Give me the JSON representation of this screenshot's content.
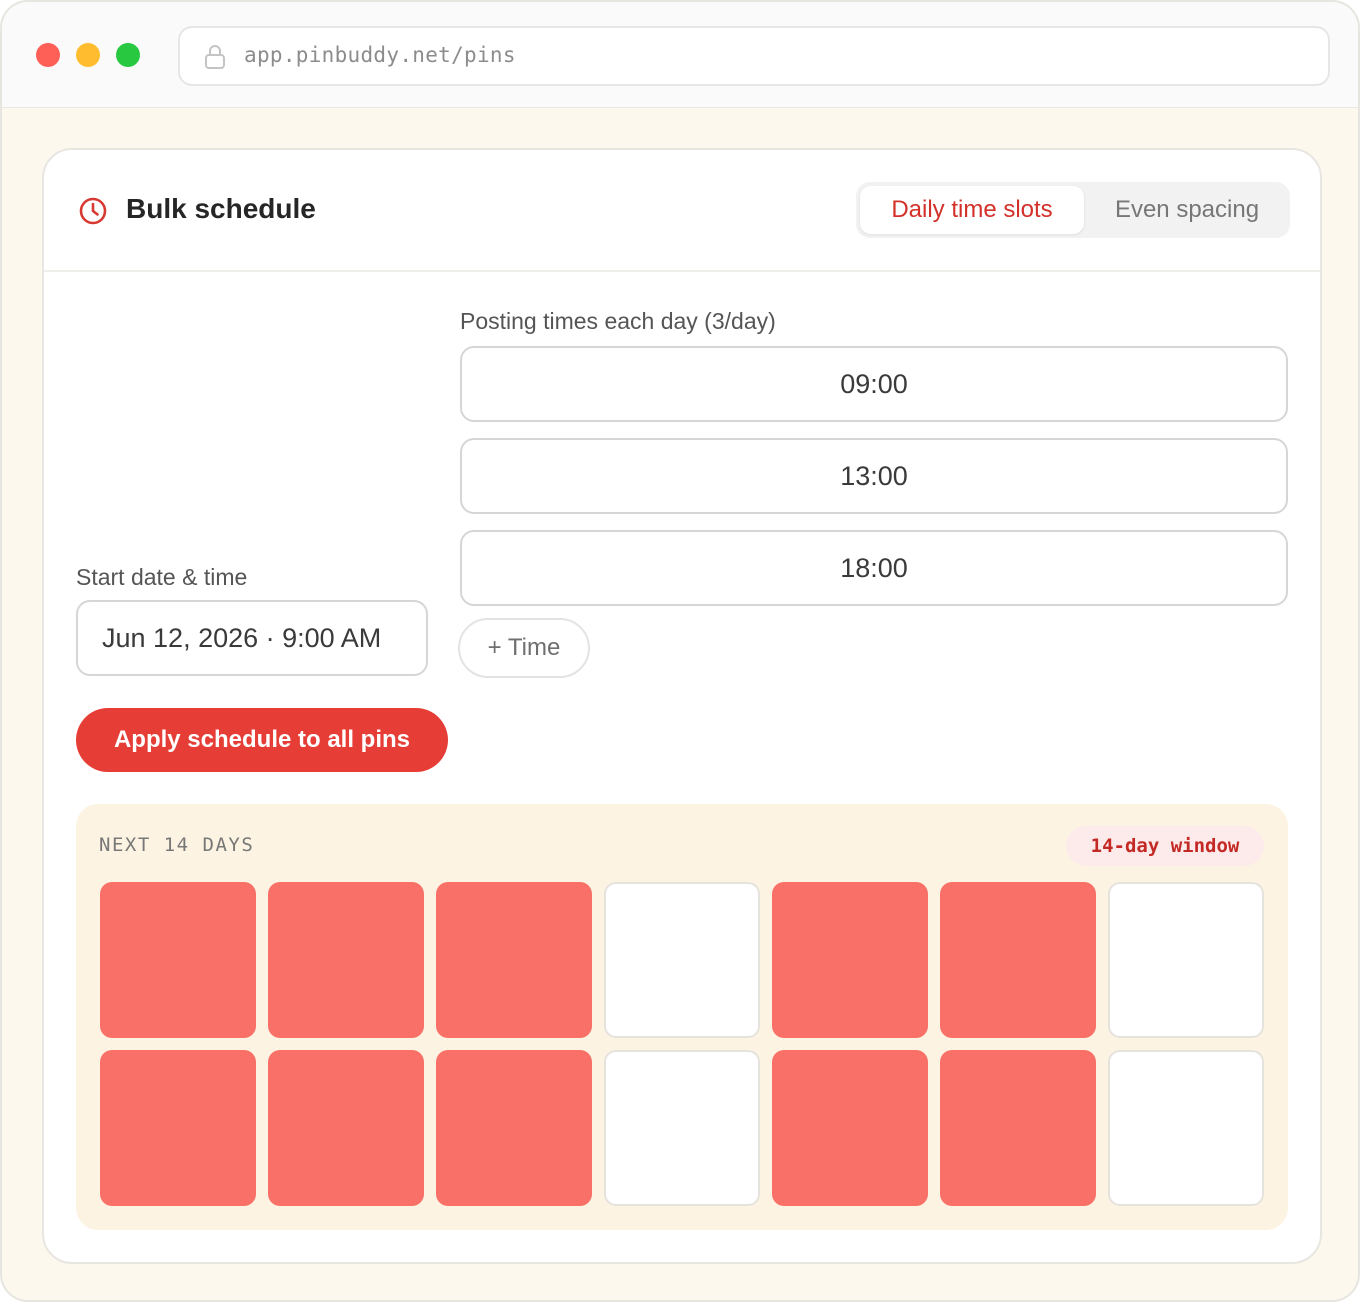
{
  "browser": {
    "url": "app.pinbuddy.net/pins"
  },
  "card": {
    "title": "Bulk schedule",
    "modes": {
      "active": "Daily time slots",
      "inactive": "Even spacing"
    }
  },
  "posting": {
    "label": "Posting times each day (3/day)",
    "times": [
      "09:00",
      "13:00",
      "18:00"
    ],
    "add_label": "+ Time"
  },
  "start": {
    "label": "Start date & time",
    "value": "Jun 12, 2026 · 9:00 AM"
  },
  "apply_label": "Apply schedule to all pins",
  "preview": {
    "title": "NEXT 14 DAYS",
    "badge": "14-day window",
    "days": [
      true,
      true,
      true,
      false,
      true,
      true,
      false,
      true,
      true,
      true,
      false,
      true,
      true,
      false
    ]
  },
  "colors": {
    "accent": "#e63d37",
    "scheduled_day": "#f87068",
    "empty_day": "#ffffff"
  }
}
